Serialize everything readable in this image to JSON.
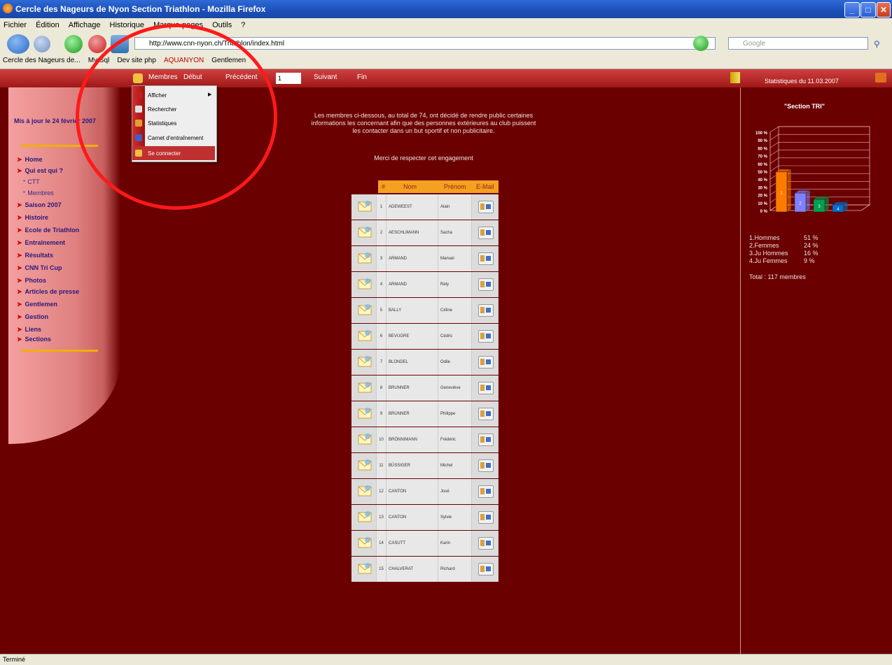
{
  "window": {
    "title": "Cercle des Nageurs de Nyon Section Triathlon - Mozilla Firefox"
  },
  "menubar": [
    "Fichier",
    "Édition",
    "Affichage",
    "Historique",
    "Marque-pages",
    "Outils",
    "?"
  ],
  "urlbar": {
    "url": "http://www.cnn-nyon.ch/Triathlon/index.html"
  },
  "search": {
    "placeholder": "Google"
  },
  "bookmarks": [
    "Cercle des Nageurs de...",
    "My Sql",
    "Dev site php",
    "AQUANYON",
    "Gentlemen"
  ],
  "topnav": {
    "membres": "Membres",
    "debut": "Début",
    "precedent": "Précédent",
    "page": "1",
    "suivant": "Suivant",
    "fin": "Fin",
    "stats": "Statistiques du 11.03.2007"
  },
  "dropdown": {
    "items": [
      "Afficher",
      "Rechercher",
      "Statistiques",
      "Carnet d'entraînement",
      "Se connecter"
    ]
  },
  "sidebar": {
    "updated": "Mis à jour le 24 février 2007",
    "items": [
      "Home",
      "Qui est qui ?",
      "Saison 2007",
      "Histoire",
      "Ecole de Triathlon",
      "Entraînement",
      "Résultats",
      "CNN Tri Cup",
      "Photos",
      "Articles de presse",
      "Gentlemen",
      "Gestion",
      "Liens",
      "Sections"
    ],
    "subitems": [
      "CTT",
      "Membres"
    ]
  },
  "intro": {
    "text": "Les membres ci-dessous, au total de 74, ont décidé de rendre public certaines informations les concernant afin que des personnes extérieures au club puissent les contacter dans un but sportif et non publicitaire.",
    "merci": "Merci de respecter cet engagement"
  },
  "table": {
    "headers": [
      "#",
      "Nom",
      "Prénom",
      "E-Mail"
    ],
    "rows": [
      {
        "n": "1",
        "nom": "ADEWEEST",
        "prenom": "Alain"
      },
      {
        "n": "2",
        "nom": "AESCHLIMANN",
        "prenom": "Sacha"
      },
      {
        "n": "3",
        "nom": "ARMAND",
        "prenom": "Manuel"
      },
      {
        "n": "4",
        "nom": "ARMAND",
        "prenom": "Rely"
      },
      {
        "n": "5",
        "nom": "BALLY",
        "prenom": "Céline"
      },
      {
        "n": "6",
        "nom": "BEVUGRE",
        "prenom": "Cédric"
      },
      {
        "n": "7",
        "nom": "BLONDEL",
        "prenom": "Odile"
      },
      {
        "n": "8",
        "nom": "BRUNNER",
        "prenom": "Geneviève"
      },
      {
        "n": "9",
        "nom": "BRUNNER",
        "prenom": "Philippe"
      },
      {
        "n": "10",
        "nom": "BRÖNNIMANN",
        "prenom": "Frédéric"
      },
      {
        "n": "11",
        "nom": "BÜSSIGER",
        "prenom": "Michel"
      },
      {
        "n": "12",
        "nom": "CANTON",
        "prenom": "José"
      },
      {
        "n": "13",
        "nom": "CANTON",
        "prenom": "Sylvie"
      },
      {
        "n": "14",
        "nom": "CASUTT",
        "prenom": "Karin"
      },
      {
        "n": "15",
        "nom": "CHALVERAT",
        "prenom": "Richard"
      }
    ]
  },
  "chart_data": {
    "type": "bar",
    "title": "\"Section TRI\"",
    "categories": [
      "1",
      "2",
      "3",
      "4"
    ],
    "values": [
      51,
      24,
      16,
      9
    ],
    "ylim": [
      0,
      100
    ],
    "yticks": [
      "0 %",
      "10 %",
      "20 %",
      "30 %",
      "40 %",
      "50 %",
      "60 %",
      "70 %",
      "80 %",
      "90 %",
      "100 %"
    ],
    "colors": [
      "#ff7a00",
      "#8080ff",
      "#00a050",
      "#0070d0"
    ]
  },
  "stats": {
    "lines": [
      {
        "label": "1.Hommes",
        "pct": "51 %"
      },
      {
        "label": "2.Femmes",
        "pct": "24 %"
      },
      {
        "label": "3.Ju Hommes",
        "pct": "16 %"
      },
      {
        "label": "4.Ju Femmes",
        "pct": "9 %"
      }
    ],
    "total": "Total : 117 membres"
  },
  "status": {
    "text": "Terminé"
  }
}
